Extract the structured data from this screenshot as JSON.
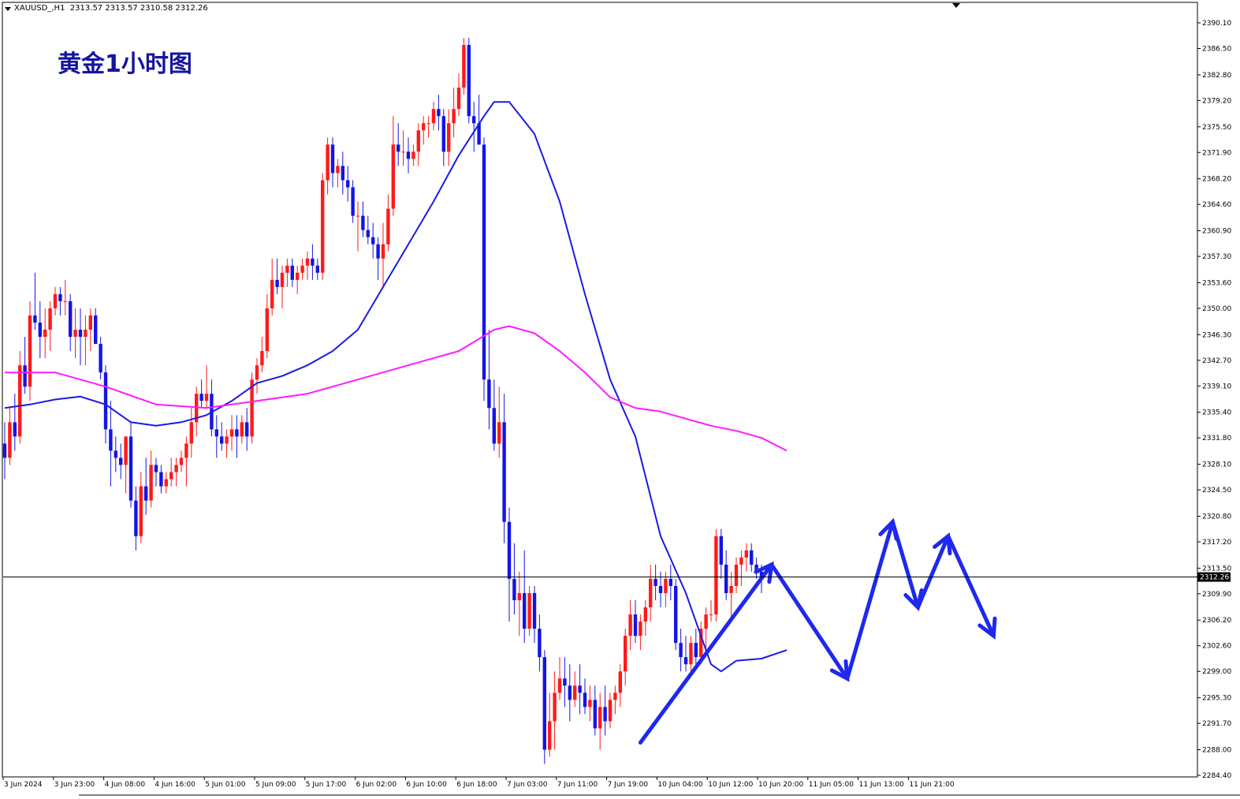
{
  "header": {
    "symbol": "XAUUSD_,H1",
    "ohlc": "2313.57 2313.57 2310.58 2312.26"
  },
  "title": "黄金1小时图",
  "colors": {
    "bull": "#ff1a1a",
    "bear": "#1414e6",
    "ma_fast": "#1a1ae6",
    "ma_slow": "#ff1aff",
    "arrow": "#1e28ee"
  },
  "chart_data": {
    "type": "candlestick",
    "symbol": "XAUUSD",
    "timeframe": "H1",
    "ylim": [
      2284.4,
      2391.5
    ],
    "y_ticks": [
      "2390.10",
      "2386.50",
      "2382.80",
      "2379.20",
      "2375.50",
      "2371.90",
      "2368.20",
      "2364.60",
      "2360.90",
      "2357.30",
      "2353.60",
      "2350.00",
      "2346.30",
      "2342.70",
      "2339.10",
      "2335.40",
      "2331.80",
      "2328.10",
      "2324.50",
      "2320.80",
      "2317.20",
      "2313.50",
      "2309.90",
      "2306.20",
      "2302.60",
      "2299.00",
      "2295.30",
      "2291.70",
      "2288.00",
      "2284.40"
    ],
    "x_ticks": [
      "3 Jun 2024",
      "3 Jun 23:00",
      "4 Jun 08:00",
      "4 Jun 16:00",
      "5 Jun 01:00",
      "5 Jun 09:00",
      "5 Jun 17:00",
      "6 Jun 02:00",
      "6 Jun 10:00",
      "6 Jun 18:00",
      "7 Jun 03:00",
      "7 Jun 11:00",
      "7 Jun 19:00",
      "10 Jun 04:00",
      "10 Jun 12:00",
      "10 Jun 20:00",
      "11 Jun 05:00",
      "11 Jun 13:00",
      "11 Jun 21:00"
    ],
    "current_price": "2312.26",
    "candles": [
      [
        2331,
        2334,
        2326,
        2329
      ],
      [
        2329,
        2336,
        2328,
        2334
      ],
      [
        2334,
        2338,
        2330,
        2332
      ],
      [
        2332,
        2344,
        2331,
        2342
      ],
      [
        2342,
        2346,
        2338,
        2339
      ],
      [
        2339,
        2351,
        2337,
        2349
      ],
      [
        2349,
        2355,
        2347,
        2348
      ],
      [
        2348,
        2351,
        2343,
        2346
      ],
      [
        2346,
        2350,
        2343,
        2347
      ],
      [
        2347,
        2351,
        2344,
        2350
      ],
      [
        2350,
        2353,
        2349,
        2352
      ],
      [
        2352,
        2353,
        2349,
        2351
      ],
      [
        2351,
        2354,
        2349,
        2351
      ],
      [
        2351,
        2352,
        2344,
        2346
      ],
      [
        2346,
        2350,
        2343,
        2347
      ],
      [
        2347,
        2350,
        2342,
        2346
      ],
      [
        2346,
        2349,
        2342,
        2347
      ],
      [
        2347,
        2350,
        2344,
        2349
      ],
      [
        2349,
        2350,
        2345,
        2345
      ],
      [
        2345,
        2346,
        2340,
        2341
      ],
      [
        2341,
        2342,
        2331,
        2333
      ],
      [
        2333,
        2337,
        2325,
        2330
      ],
      [
        2330,
        2332,
        2327,
        2329
      ],
      [
        2329,
        2331,
        2326,
        2328
      ],
      [
        2328,
        2332,
        2324,
        2332
      ],
      [
        2332,
        2334,
        2322,
        2323
      ],
      [
        2323,
        2325,
        2316,
        2318
      ],
      [
        2318,
        2327,
        2317,
        2325
      ],
      [
        2325,
        2329,
        2321,
        2323
      ],
      [
        2323,
        2330,
        2322,
        2328
      ],
      [
        2328,
        2329,
        2325,
        2327
      ],
      [
        2327,
        2328,
        2324,
        2325
      ],
      [
        2325,
        2327,
        2324,
        2326
      ],
      [
        2326,
        2329,
        2325,
        2327
      ],
      [
        2327,
        2329,
        2325,
        2328
      ],
      [
        2328,
        2330,
        2327,
        2329
      ],
      [
        2329,
        2332,
        2325,
        2331
      ],
      [
        2331,
        2336,
        2329,
        2334
      ],
      [
        2334,
        2339,
        2332,
        2338
      ],
      [
        2338,
        2340,
        2336,
        2337
      ],
      [
        2337,
        2342,
        2336,
        2338
      ],
      [
        2338,
        2340,
        2332,
        2333
      ],
      [
        2333,
        2335,
        2329,
        2332
      ],
      [
        2332,
        2334,
        2330,
        2331
      ],
      [
        2331,
        2333,
        2329,
        2332
      ],
      [
        2332,
        2335,
        2330,
        2333
      ],
      [
        2333,
        2335,
        2329,
        2332
      ],
      [
        2332,
        2335,
        2331,
        2334
      ],
      [
        2334,
        2336,
        2330,
        2332
      ],
      [
        2332,
        2341,
        2331,
        2340
      ],
      [
        2340,
        2343,
        2338,
        2342
      ],
      [
        2342,
        2346,
        2341,
        2344
      ],
      [
        2344,
        2352,
        2343,
        2350
      ],
      [
        2350,
        2357,
        2349,
        2354
      ],
      [
        2354,
        2357,
        2352,
        2353
      ],
      [
        2353,
        2356,
        2350,
        2355
      ],
      [
        2355,
        2357,
        2353,
        2356
      ],
      [
        2356,
        2357,
        2353,
        2354
      ],
      [
        2354,
        2356,
        2352,
        2355
      ],
      [
        2355,
        2357,
        2354,
        2356
      ],
      [
        2356,
        2358,
        2354,
        2357
      ],
      [
        2357,
        2359,
        2354,
        2356
      ],
      [
        2356,
        2357,
        2354,
        2355
      ],
      [
        2355,
        2369,
        2354,
        2368
      ],
      [
        2368,
        2374,
        2366,
        2373
      ],
      [
        2373,
        2374,
        2367,
        2369
      ],
      [
        2369,
        2371,
        2367,
        2370
      ],
      [
        2370,
        2372,
        2366,
        2368
      ],
      [
        2368,
        2370,
        2365,
        2367
      ],
      [
        2367,
        2368,
        2362,
        2363
      ],
      [
        2363,
        2365,
        2358,
        2363
      ],
      [
        2363,
        2365,
        2360,
        2361
      ],
      [
        2361,
        2363,
        2359,
        2360
      ],
      [
        2360,
        2362,
        2357,
        2359
      ],
      [
        2359,
        2360,
        2354,
        2357
      ],
      [
        2357,
        2362,
        2353,
        2359
      ],
      [
        2359,
        2366,
        2358,
        2364
      ],
      [
        2364,
        2377,
        2363,
        2373
      ],
      [
        2373,
        2376,
        2370,
        2372
      ],
      [
        2372,
        2375,
        2370,
        2372
      ],
      [
        2372,
        2374,
        2369,
        2371
      ],
      [
        2371,
        2373,
        2370,
        2372
      ],
      [
        2372,
        2376,
        2370,
        2375
      ],
      [
        2375,
        2377,
        2373,
        2376
      ],
      [
        2376,
        2377,
        2374,
        2376
      ],
      [
        2376,
        2379,
        2375,
        2378
      ],
      [
        2378,
        2380,
        2375,
        2377
      ],
      [
        2377,
        2378,
        2370,
        2372
      ],
      [
        2372,
        2378,
        2370,
        2376
      ],
      [
        2376,
        2381,
        2374,
        2378
      ],
      [
        2378,
        2383,
        2377,
        2381
      ],
      [
        2381,
        2388,
        2380,
        2387
      ],
      [
        2387,
        2388,
        2376,
        2377
      ],
      [
        2377,
        2379,
        2372,
        2376
      ],
      [
        2376,
        2380,
        2373,
        2373
      ],
      [
        2373,
        2374,
        2337,
        2340
      ],
      [
        2340,
        2347,
        2333,
        2336
      ],
      [
        2336,
        2340,
        2330,
        2331
      ],
      [
        2331,
        2339,
        2329,
        2334
      ],
      [
        2334,
        2338,
        2317,
        2320
      ],
      [
        2320,
        2322,
        2306,
        2312
      ],
      [
        2312,
        2317,
        2307,
        2309
      ],
      [
        2309,
        2313,
        2304,
        2310
      ],
      [
        2310,
        2316,
        2303,
        2305
      ],
      [
        2305,
        2311,
        2304,
        2310
      ],
      [
        2310,
        2311,
        2303,
        2305
      ],
      [
        2305,
        2307,
        2299,
        2301
      ],
      [
        2301,
        2302,
        2286,
        2288
      ],
      [
        2288,
        2296,
        2287,
        2292
      ],
      [
        2292,
        2299,
        2288,
        2296
      ],
      [
        2296,
        2301,
        2295,
        2298
      ],
      [
        2298,
        2301,
        2294,
        2297
      ],
      [
        2297,
        2300,
        2292,
        2295
      ],
      [
        2295,
        2299,
        2294,
        2297
      ],
      [
        2297,
        2300,
        2293,
        2296
      ],
      [
        2296,
        2298,
        2293,
        2294
      ],
      [
        2294,
        2297,
        2292,
        2295
      ],
      [
        2295,
        2297,
        2290,
        2291
      ],
      [
        2291,
        2296,
        2288,
        2294
      ],
      [
        2294,
        2297,
        2290,
        2292
      ],
      [
        2292,
        2296,
        2291,
        2295
      ],
      [
        2295,
        2297,
        2293,
        2296
      ],
      [
        2296,
        2300,
        2294,
        2299
      ],
      [
        2299,
        2305,
        2297,
        2304
      ],
      [
        2304,
        2309,
        2302,
        2307
      ],
      [
        2307,
        2309,
        2303,
        2304
      ],
      [
        2304,
        2307,
        2302,
        2306
      ],
      [
        2306,
        2309,
        2304,
        2308
      ],
      [
        2308,
        2314,
        2306,
        2312
      ],
      [
        2312,
        2314,
        2309,
        2311
      ],
      [
        2311,
        2313,
        2308,
        2310
      ],
      [
        2310,
        2313,
        2308,
        2312
      ],
      [
        2312,
        2314,
        2309,
        2311
      ],
      [
        2311,
        2312,
        2302,
        2303
      ],
      [
        2303,
        2305,
        2299,
        2301
      ],
      [
        2301,
        2304,
        2299,
        2300
      ],
      [
        2300,
        2304,
        2299,
        2303
      ],
      [
        2303,
        2305,
        2300,
        2301
      ],
      [
        2301,
        2306,
        2300,
        2305
      ],
      [
        2305,
        2308,
        2302,
        2307
      ],
      [
        2307,
        2309,
        2306,
        2307
      ],
      [
        2307,
        2319,
        2306,
        2318
      ],
      [
        2318,
        2319,
        2312,
        2314
      ],
      [
        2314,
        2316,
        2309,
        2310
      ],
      [
        2310,
        2313,
        2306,
        2311
      ],
      [
        2311,
        2315,
        2310,
        2314
      ],
      [
        2314,
        2316,
        2311,
        2315
      ],
      [
        2315,
        2317,
        2313,
        2316
      ],
      [
        2316,
        2317,
        2313,
        2314
      ],
      [
        2314,
        2315,
        2312,
        2313
      ],
      [
        2313,
        2314,
        2310,
        2312
      ]
    ],
    "series": [
      {
        "name": "",
        "type": "line",
        "x": [
          0,
          5,
          10,
          15,
          20,
          25,
          30,
          35,
          40,
          45,
          50,
          55,
          60,
          65,
          70,
          75,
          80,
          85,
          90,
          95,
          97,
          100,
          105,
          110,
          115,
          120,
          125,
          130,
          135,
          140,
          142,
          145,
          150,
          155
        ],
        "values": [
          2336.0,
          2336.5,
          2337.2,
          2337.6,
          2336.5,
          2334.0,
          2333.5,
          2334.0,
          2335.0,
          2337.0,
          2339.5,
          2340.5,
          2342.0,
          2344.0,
          2347.0,
          2353.0,
          2359.0,
          2365.0,
          2371.5,
          2377.0,
          2379.0,
          2379.0,
          2374.5,
          2365.0,
          2352.0,
          2340.0,
          2332.0,
          2318.0,
          2310.0,
          2300.0,
          2299.0,
          2300.5,
          2300.8,
          2302.0
        ]
      },
      {
        "name": "",
        "type": "line",
        "x": [
          0,
          10,
          20,
          30,
          40,
          50,
          60,
          70,
          80,
          90,
          97,
          100,
          105,
          110,
          115,
          120,
          125,
          130,
          135,
          140,
          145,
          150,
          155
        ],
        "values": [
          2341.0,
          2341.0,
          2339.0,
          2336.5,
          2336.0,
          2337.0,
          2338.0,
          2340.0,
          2342.0,
          2344.0,
          2347.0,
          2347.5,
          2346.5,
          2344.0,
          2341.0,
          2337.5,
          2336.0,
          2335.5,
          2334.5,
          2333.5,
          2332.8,
          2331.8,
          2330.0
        ]
      }
    ],
    "arrows": [
      [
        [
          126,
          2289
        ],
        [
          152,
          2314
        ]
      ],
      [
        [
          152,
          2314
        ],
        [
          167,
          2298
        ]
      ],
      [
        [
          167,
          2298
        ],
        [
          176,
          2320
        ]
      ],
      [
        [
          176,
          2320
        ],
        [
          181,
          2308
        ]
      ],
      [
        [
          181,
          2308
        ],
        [
          187,
          2318
        ]
      ],
      [
        [
          187,
          2318
        ],
        [
          196,
          2304
        ]
      ]
    ]
  }
}
